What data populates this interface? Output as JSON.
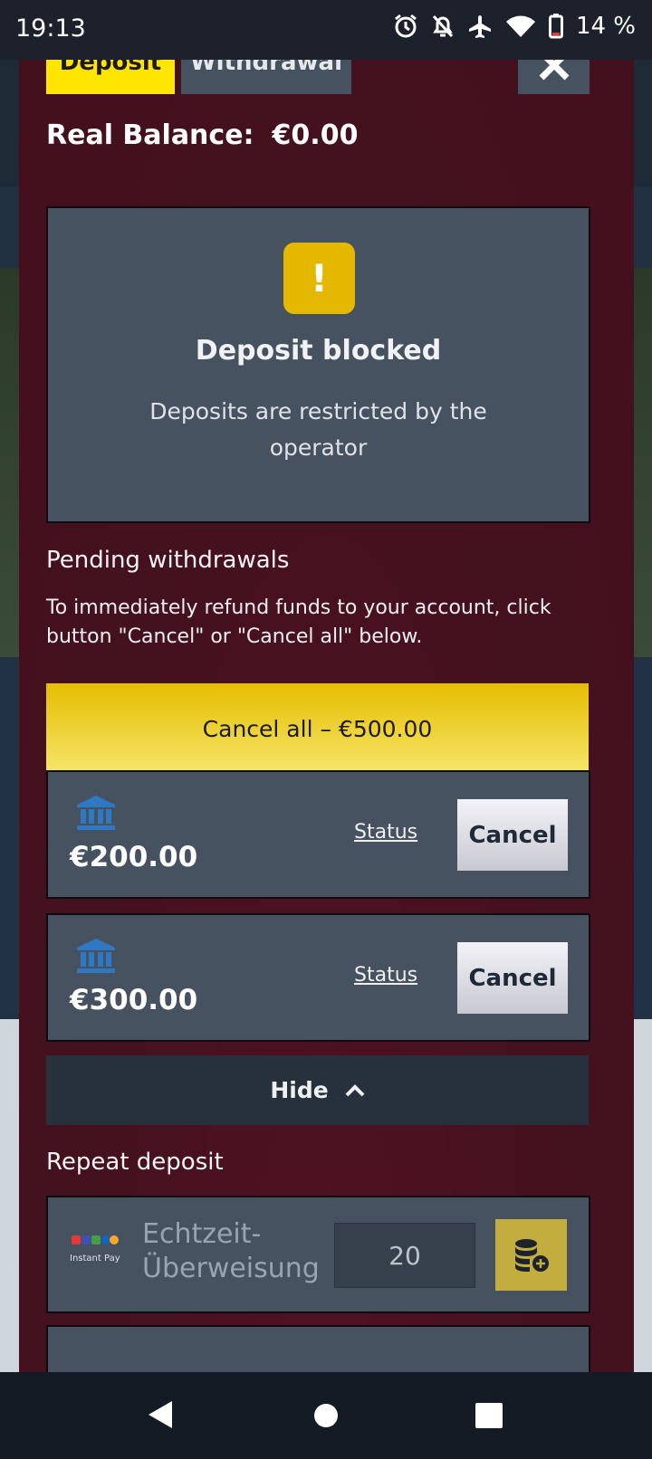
{
  "status_bar": {
    "time": "19:13",
    "battery": "14 %",
    "icons": [
      "alarm-icon",
      "notifications-off-icon",
      "airplane-icon",
      "wifi-icon",
      "battery-low-icon"
    ]
  },
  "tabs": {
    "deposit": "Deposit",
    "withdrawal": "Withdrawal"
  },
  "balance": {
    "label": "Real Balance:",
    "value": "€0.00"
  },
  "blocked": {
    "icon_glyph": "!",
    "title": "Deposit blocked",
    "message": "Deposits are restricted by the operator"
  },
  "pending": {
    "title": "Pending withdrawals",
    "info": "To immediately refund funds to your account, click button \"Cancel\" or \"Cancel all\" below.",
    "cancel_all_label": "Cancel all – €500.00",
    "items": [
      {
        "amount": "€200.00",
        "status_label": "Status",
        "cancel_label": "Cancel"
      },
      {
        "amount": "€300.00",
        "status_label": "Status",
        "cancel_label": "Cancel"
      }
    ],
    "hide_label": "Hide"
  },
  "repeat": {
    "title": "Repeat deposit",
    "method_logo_text": "Instant Pay",
    "method_name": "Echtzeit-Überweisung",
    "amount": "20"
  },
  "colors": {
    "accent_yellow": "#ffe500",
    "card_bg": "#475260",
    "modal_bg": "#47121f",
    "bank_icon": "#2f78c4"
  }
}
